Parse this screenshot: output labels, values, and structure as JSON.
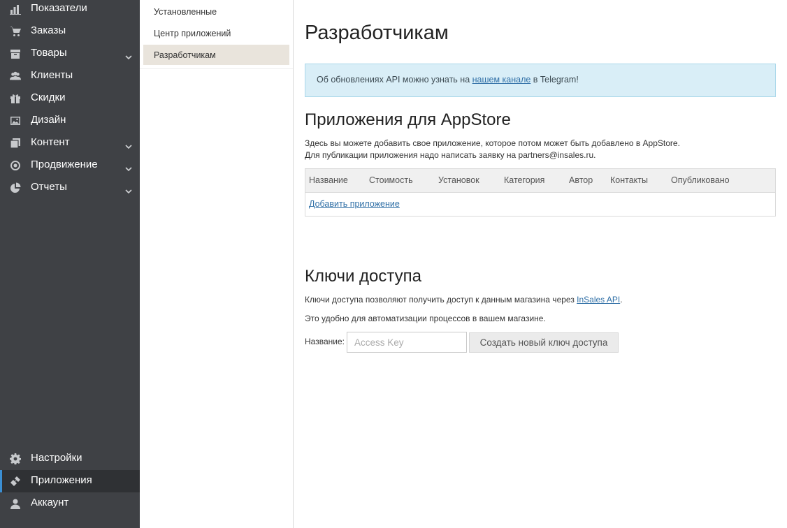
{
  "sidebar": {
    "items": [
      {
        "label": "Показатели",
        "icon": "bar-chart-icon",
        "chevron": false
      },
      {
        "label": "Заказы",
        "icon": "cart-icon",
        "chevron": false
      },
      {
        "label": "Товары",
        "icon": "box-icon",
        "chevron": true
      },
      {
        "label": "Клиенты",
        "icon": "users-icon",
        "chevron": false
      },
      {
        "label": "Скидки",
        "icon": "gift-icon",
        "chevron": false
      },
      {
        "label": "Дизайн",
        "icon": "image-icon",
        "chevron": false
      },
      {
        "label": "Контент",
        "icon": "pages-icon",
        "chevron": true
      },
      {
        "label": "Продвижение",
        "icon": "target-icon",
        "chevron": true
      },
      {
        "label": "Отчеты",
        "icon": "pie-chart-icon",
        "chevron": true
      }
    ],
    "bottom_items": [
      {
        "label": "Настройки",
        "icon": "gear-icon"
      },
      {
        "label": "Приложения",
        "icon": "puzzle-icon",
        "active": true
      },
      {
        "label": "Аккаунт",
        "icon": "user-icon"
      }
    ],
    "accent_color": "#3b8fd3"
  },
  "subnav": {
    "items": [
      {
        "label": "Установленные"
      },
      {
        "label": "Центр приложений"
      },
      {
        "label": "Разработчикам",
        "active": true
      }
    ]
  },
  "main": {
    "title": "Разработчикам",
    "notice": {
      "before": "Об обновлениях API можно узнать на ",
      "link": "нашем канале",
      "after": " в Telegram!"
    },
    "appstore": {
      "title": "Приложения для AppStore",
      "line1": "Здесь вы можете добавить свое приложение, которое потом может быть добавлено в AppStore.",
      "line2": "Для публикации приложения надо написать заявку на partners@insales.ru.",
      "columns": [
        "Название",
        "Стоимость",
        "Установок",
        "Категория",
        "Автор",
        "Контакты",
        "Опубликовано"
      ],
      "add_link": "Добавить приложение"
    },
    "keys": {
      "title": "Ключи доступа",
      "line1_before": "Ключи доступа позволяют получить доступ к данным магазина через ",
      "line1_link": "InSales API",
      "line1_after": ".",
      "line2": "Это удобно для автоматизации процессов в вашем магазине.",
      "name_label": "Название:",
      "name_placeholder": "Access Key",
      "name_value": "",
      "create_button": "Создать новый ключ доступа"
    }
  }
}
